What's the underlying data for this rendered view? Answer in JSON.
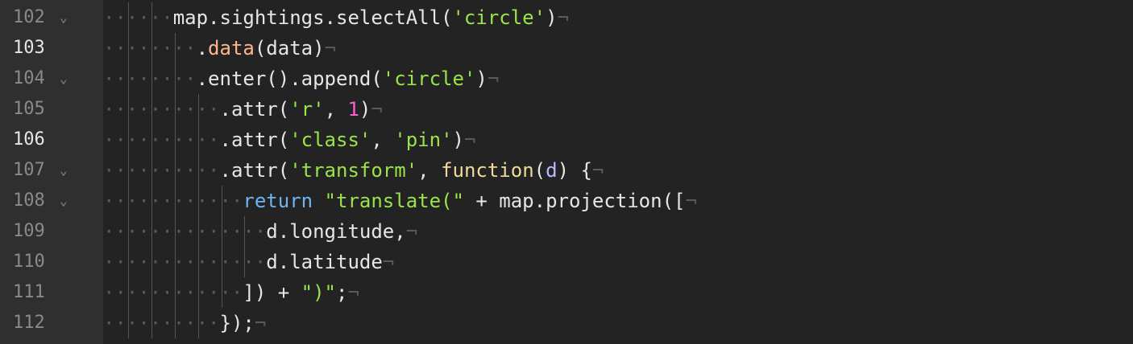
{
  "editor": {
    "lines": [
      {
        "number": "102",
        "foldable": true,
        "active": false,
        "indent": "······",
        "tokens": [
          {
            "t": "map.sightings.selectAll(",
            "c": ""
          },
          {
            "t": "'circle'",
            "c": "str"
          },
          {
            "t": ")",
            "c": ""
          }
        ]
      },
      {
        "number": "103",
        "foldable": false,
        "active": true,
        "indent": "········",
        "tokens": [
          {
            "t": ".",
            "c": ""
          },
          {
            "t": "data",
            "c": "method"
          },
          {
            "t": "(data)",
            "c": ""
          }
        ]
      },
      {
        "number": "104",
        "foldable": true,
        "active": false,
        "indent": "········",
        "tokens": [
          {
            "t": ".enter().append(",
            "c": ""
          },
          {
            "t": "'circle'",
            "c": "str"
          },
          {
            "t": ")",
            "c": ""
          }
        ]
      },
      {
        "number": "105",
        "foldable": false,
        "active": false,
        "indent": "··········",
        "tokens": [
          {
            "t": ".attr(",
            "c": ""
          },
          {
            "t": "'r'",
            "c": "str"
          },
          {
            "t": ", ",
            "c": ""
          },
          {
            "t": "1",
            "c": "num"
          },
          {
            "t": ")",
            "c": ""
          }
        ]
      },
      {
        "number": "106",
        "foldable": false,
        "active": true,
        "indent": "··········",
        "tokens": [
          {
            "t": ".attr(",
            "c": ""
          },
          {
            "t": "'class'",
            "c": "str"
          },
          {
            "t": ", ",
            "c": ""
          },
          {
            "t": "'pin'",
            "c": "str"
          },
          {
            "t": ")",
            "c": ""
          }
        ]
      },
      {
        "number": "107",
        "foldable": true,
        "active": false,
        "indent": "··········",
        "tokens": [
          {
            "t": ".attr(",
            "c": ""
          },
          {
            "t": "'transform'",
            "c": "str"
          },
          {
            "t": ", ",
            "c": ""
          },
          {
            "t": "function",
            "c": "fn"
          },
          {
            "t": "(",
            "c": ""
          },
          {
            "t": "d",
            "c": "param"
          },
          {
            "t": ") {",
            "c": ""
          }
        ]
      },
      {
        "number": "108",
        "foldable": true,
        "active": false,
        "indent": "············",
        "tokens": [
          {
            "t": "return",
            "c": "kw"
          },
          {
            "t": " ",
            "c": ""
          },
          {
            "t": "\"translate(\"",
            "c": "str"
          },
          {
            "t": " + map.projection([",
            "c": ""
          }
        ]
      },
      {
        "number": "109",
        "foldable": false,
        "active": false,
        "indent": "··············",
        "tokens": [
          {
            "t": "d.longitude,",
            "c": ""
          }
        ]
      },
      {
        "number": "110",
        "foldable": false,
        "active": false,
        "indent": "··············",
        "tokens": [
          {
            "t": "d.latitude",
            "c": ""
          }
        ]
      },
      {
        "number": "111",
        "foldable": false,
        "active": false,
        "indent": "············",
        "tokens": [
          {
            "t": "]) + ",
            "c": ""
          },
          {
            "t": "\")\"",
            "c": "str"
          },
          {
            "t": ";",
            "c": ""
          }
        ]
      },
      {
        "number": "112",
        "foldable": false,
        "active": false,
        "indent": "··········",
        "tokens": [
          {
            "t": "});",
            "c": ""
          }
        ]
      }
    ],
    "eol_marker": "¬",
    "fold_marker": "⌄"
  }
}
